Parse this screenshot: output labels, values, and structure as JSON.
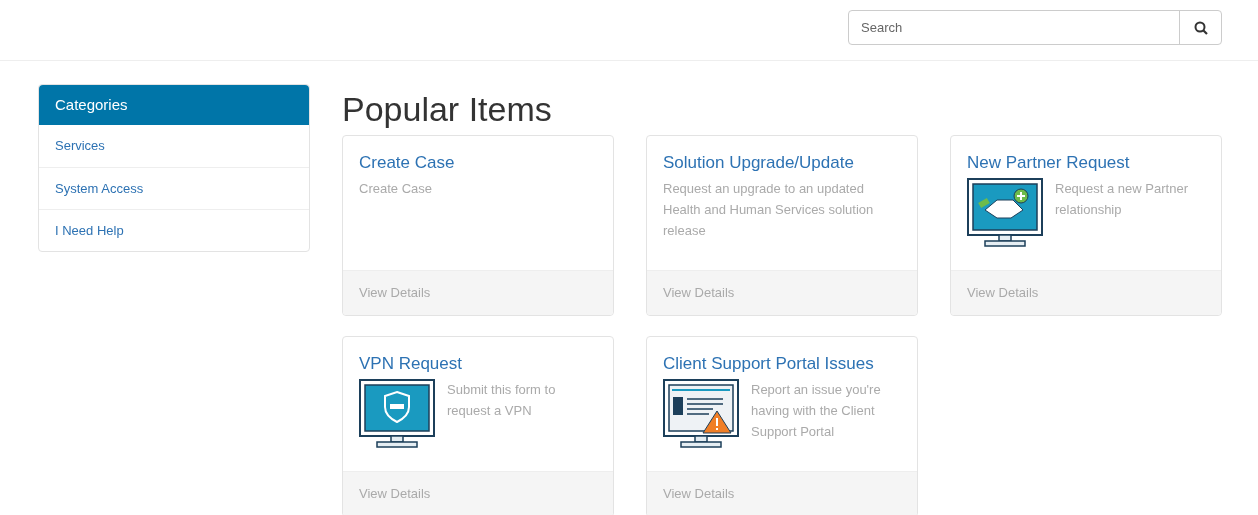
{
  "search": {
    "placeholder": "Search"
  },
  "sidebar": {
    "title": "Categories",
    "items": [
      {
        "label": "Services"
      },
      {
        "label": "System Access"
      },
      {
        "label": "I Need Help"
      }
    ]
  },
  "main": {
    "title": "Popular Items",
    "cards": [
      {
        "title": "Create Case",
        "description": "Create Case",
        "kind": "text",
        "footer": "View Details"
      },
      {
        "title": "Solution Upgrade/Update",
        "description": "Request an upgrade to an updated Health and Human Services solution release",
        "kind": "text",
        "footer": "View Details"
      },
      {
        "title": "New Partner Request",
        "description": "Request a new Partner relationship",
        "kind": "partner",
        "footer": "View Details"
      },
      {
        "title": "VPN Request",
        "description": "Submit this form to request a VPN",
        "kind": "vpn",
        "footer": "View Details"
      },
      {
        "title": "Client Support Portal Issues",
        "description": "Report an issue you're having with the Client Support Portal",
        "kind": "portal",
        "footer": "View Details"
      }
    ]
  }
}
